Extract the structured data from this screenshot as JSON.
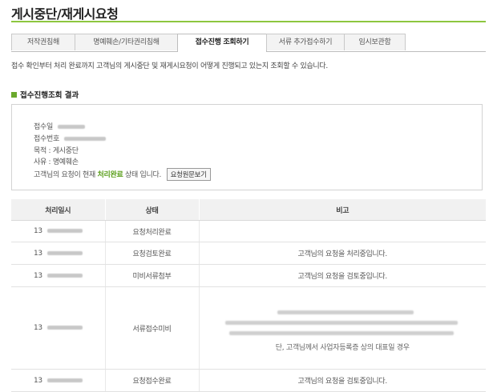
{
  "page": {
    "title": "게시중단/재게시요청"
  },
  "tabs": [
    {
      "label": "저작권침해",
      "active": false
    },
    {
      "label": "명예훼손/기타권리침해",
      "active": false
    },
    {
      "label": "접수진행 조회하기",
      "active": true
    },
    {
      "label": "서류 추가접수하기",
      "active": false
    },
    {
      "label": "임시보관함",
      "active": false
    }
  ],
  "description": "접수 확인부터 처리 완료까지 고객님의 게시중단 및 재게시요청이 어떻게 진행되고 있는지 조회할 수 있습니다.",
  "section": {
    "title": "접수진행조회 결과"
  },
  "info": {
    "received_date_label": "접수일",
    "receipt_no_label": "접수번호",
    "purpose": "목적 : 게시중단",
    "reason": "사유 : 명예훼손",
    "status_prefix": "고객님의 요청이 현재",
    "status_value": "처리완료",
    "status_suffix": "상태 입니다.",
    "view_button": "요청원문보기"
  },
  "table": {
    "headers": [
      "처리일시",
      "상태",
      "비고"
    ],
    "rows": [
      {
        "date": "13",
        "status": "요청처리완료",
        "note": ""
      },
      {
        "date": "13",
        "status": "요청검토완료",
        "note": "고객님의 요청을 처리중입니다."
      },
      {
        "date": "13",
        "status": "미비서류첨부",
        "note": "고객님의 요청을 검토중입니다."
      },
      {
        "date": "13",
        "status": "서류접수미비",
        "note": "",
        "note_tail": "단, 고객님께서 사업자등록증 상의 대표일 경우"
      },
      {
        "date": "13",
        "status": "요청접수완료",
        "note": "고객님의 요청을 검토중입니다."
      }
    ]
  }
}
